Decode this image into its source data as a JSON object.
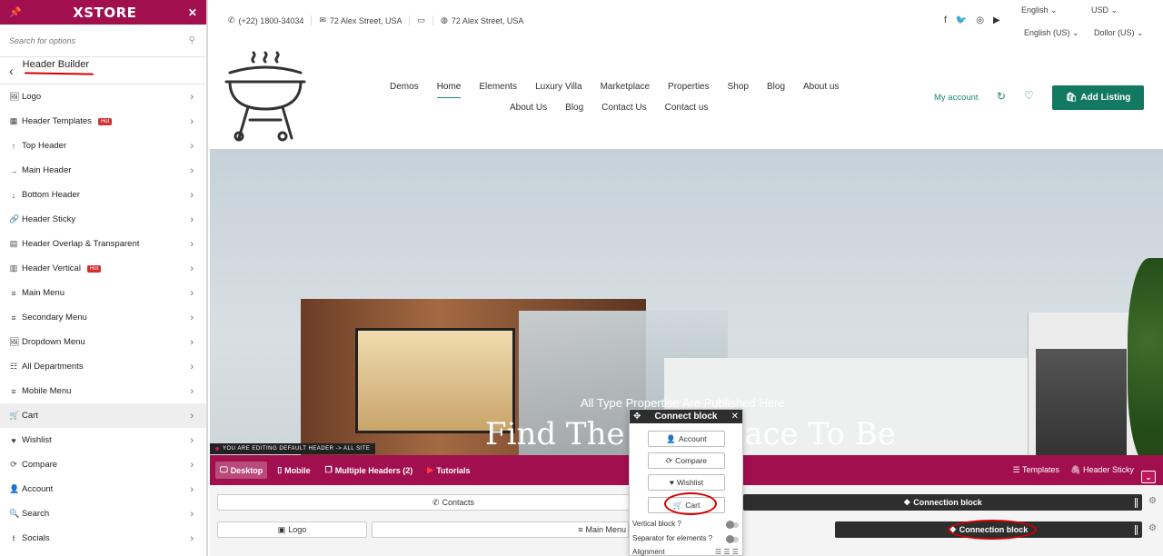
{
  "sidebar": {
    "brand": "XSTORE",
    "search_placeholder": "Search for options",
    "section_title": "Header Builder",
    "items": [
      {
        "label": "Logo",
        "icon": "image-icon"
      },
      {
        "label": "Header Templates",
        "icon": "grid-icon",
        "badge": "Hot"
      },
      {
        "label": "Top Header",
        "icon": "arrow-up-icon"
      },
      {
        "label": "Main Header",
        "icon": "arrow-right-icon"
      },
      {
        "label": "Bottom Header",
        "icon": "arrow-down-icon"
      },
      {
        "label": "Header Sticky",
        "icon": "paperclip-icon"
      },
      {
        "label": "Header Overlap & Transparent",
        "icon": "layers-icon"
      },
      {
        "label": "Header Vertical",
        "icon": "panel-icon",
        "badge": "Hot"
      },
      {
        "label": "Main Menu",
        "icon": "menu-icon"
      },
      {
        "label": "Secondary Menu",
        "icon": "menu-icon"
      },
      {
        "label": "Dropdown Menu",
        "icon": "image-icon"
      },
      {
        "label": "All Departments",
        "icon": "list-icon"
      },
      {
        "label": "Mobile Menu",
        "icon": "menu-icon"
      },
      {
        "label": "Cart",
        "icon": "cart-icon"
      },
      {
        "label": "Wishlist",
        "icon": "heart-icon"
      },
      {
        "label": "Compare",
        "icon": "compare-icon"
      },
      {
        "label": "Account",
        "icon": "user-icon"
      },
      {
        "label": "Search",
        "icon": "search-icon"
      },
      {
        "label": "Socials",
        "icon": "facebook-icon"
      }
    ],
    "active_item": "Cart"
  },
  "topbar": {
    "phone": "(+22) 1800-34034",
    "address_mail": "72 Alex Street, USA",
    "address_globe": "72 Alex Street, USA",
    "lang_top": "English",
    "currency_top": "USD",
    "lang_bottom": "English (US)",
    "currency_bottom": "Dollor (US)"
  },
  "nav": {
    "row1": [
      "Demos",
      "Home",
      "Elements",
      "Luxury Villa",
      "Marketplace",
      "Properties",
      "Shop",
      "Blog",
      "About us"
    ],
    "row2": [
      "About Us",
      "Blog",
      "Contact Us",
      "Contact us"
    ],
    "active": "Home"
  },
  "header_actions": {
    "my_account": "My account",
    "add_listing": "Add Listing"
  },
  "hero": {
    "subtitle": "All Type Propertise Are Published Here",
    "title": "Find The Best Place To Be"
  },
  "builder": {
    "edit_notice": "YOU ARE EDITING DEFAULT HEADER -> ALL SITE",
    "tabs": {
      "desktop": "Desktop",
      "mobile": "Mobile",
      "multiple": "Multiple Headers (2)",
      "tutorials": "Tutorials"
    },
    "right": {
      "templates": "Templates",
      "sticky": "Header Sticky"
    },
    "row1": {
      "contacts": "Contacts",
      "connection": "Connection block"
    },
    "row2": {
      "logo": "Logo",
      "main_menu": "Main Menu",
      "connection": "Connection block"
    }
  },
  "popup": {
    "title": "Connect block",
    "buttons": [
      "Account",
      "Compare",
      "Wishlist",
      "Cart"
    ],
    "options": {
      "vertical": "Vertical block ?",
      "separator": "Separator for elements ?",
      "alignment": "Alignment"
    }
  },
  "colors": {
    "brand": "#a20f4e",
    "accent_green": "#127862",
    "dark": "#2e2e2e",
    "annotation_red": "#d50000"
  }
}
